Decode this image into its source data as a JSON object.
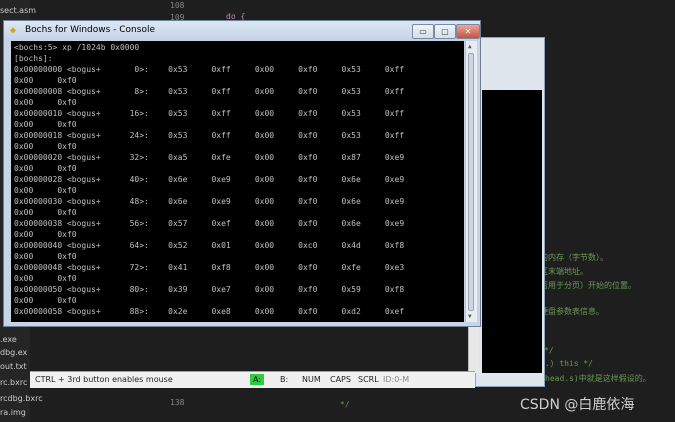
{
  "editor": {
    "files": [
      "sect.asm",
      ".exe",
      "dbg.ex",
      "out.txt",
      "rc.bxrc",
      "rcdbg.bxrc",
      "ra.img"
    ],
    "line_numbers": [
      "108",
      "109",
      "138"
    ],
    "code_keyword": "do {",
    "right_lines": [
      "的内存（字节数）。",
      "区末端地址。",
      "否用于分页）开始的位置。",
      "硬盘参数表信息。",
      "*/",
      "..) this */",
      "head.s)中就是这样假设的。",
      "*/"
    ]
  },
  "console": {
    "title": "Bochs for Windows - Console",
    "buttons": {
      "minimize": "▭",
      "restore": "▢",
      "close": "✕"
    },
    "lines": [
      "<bochs:5> xp /1024b 0x0000",
      "[bochs]:",
      "0x00000000 <bogus+       0>:    0x53     0xff     0x00     0xf0     0x53     0xff",
      "0x00     0xf0",
      "0x00000008 <bogus+       8>:    0x53     0xff     0x00     0xf0     0x53     0xff",
      "0x00     0xf0",
      "0x00000010 <bogus+      16>:    0x53     0xff     0x00     0xf0     0x53     0xff",
      "0x00     0xf0",
      "0x00000018 <bogus+      24>:    0x53     0xff     0x00     0xf0     0x53     0xff",
      "0x00     0xf0",
      "0x00000020 <bogus+      32>:    0xa5     0xfe     0x00     0xf0     0x87     0xe9",
      "0x00     0xf0",
      "0x00000028 <bogus+      40>:    0x6e     0xe9     0x00     0xf0     0x6e     0xe9",
      "0x00     0xf0",
      "0x00000030 <bogus+      48>:    0x6e     0xe9     0x00     0xf0     0x6e     0xe9",
      "0x00     0xf0",
      "0x00000038 <bogus+      56>:    0x57     0xef     0x00     0xf0     0x6e     0xe9",
      "0x00     0xf0",
      "0x00000040 <bogus+      64>:    0x52     0x01     0x00     0xc0     0x4d     0xf8",
      "0x00     0xf0",
      "0x00000048 <bogus+      72>:    0x41     0xf8     0x00     0xf0     0xfe     0xe3",
      "0x00     0xf0",
      "0x00000050 <bogus+      80>:    0x39     0xe7     0x00     0xf0     0x59     0xf8",
      "0x00     0xf0",
      "0x00000058 <bogus+      88>:    0x2e     0xe8     0x00     0xf0     0xd2     0xef"
    ]
  },
  "statusbar": {
    "mouse_hint": "CTRL + 3rd button enables mouse",
    "drive_a": "A:",
    "drive_b": "B:",
    "num": "NUM",
    "caps": "CAPS",
    "scrl": "SCRL",
    "id": "ID:0-M"
  },
  "watermark": "CSDN @白鹿依海"
}
